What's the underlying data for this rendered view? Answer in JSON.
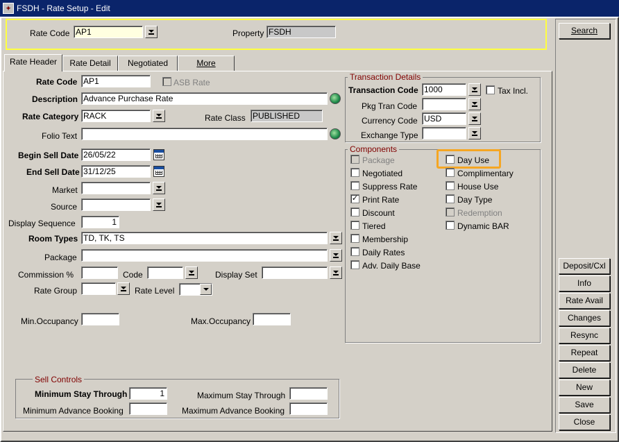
{
  "window": {
    "title": "FSDH - Rate Setup - Edit"
  },
  "header": {
    "rate_code_label": "Rate Code",
    "rate_code_value": "AP1",
    "property_label": "Property",
    "property_value": "FSDH"
  },
  "tabs": [
    {
      "label": "Rate Header",
      "active": true
    },
    {
      "label": "Rate Detail",
      "active": false
    },
    {
      "label": "Negotiated",
      "active": false
    },
    {
      "label": "More",
      "active": false
    }
  ],
  "form": {
    "rate_code_label": "Rate Code",
    "rate_code_value": "AP1",
    "asb_rate_label": "ASB Rate",
    "description_label": "Description",
    "description_value": "Advance Purchase Rate",
    "rate_category_label": "Rate Category",
    "rate_category_value": "RACK",
    "rate_class_label": "Rate Class",
    "rate_class_value": "PUBLISHED",
    "folio_text_label": "Folio Text",
    "folio_text_value": "",
    "begin_sell_date_label": "Begin Sell Date",
    "begin_sell_date_value": "26/05/22",
    "end_sell_date_label": "End Sell Date",
    "end_sell_date_value": "31/12/25",
    "market_label": "Market",
    "market_value": "",
    "source_label": "Source",
    "source_value": "",
    "display_sequence_label": "Display Sequence",
    "display_sequence_value": "1",
    "room_types_label": "Room Types",
    "room_types_value": "TD, TK, TS",
    "package_label": "Package",
    "package_value": "",
    "commission_label": "Commission %",
    "commission_value": "",
    "code_label": "Code",
    "code_value": "",
    "display_set_label": "Display Set",
    "display_set_value": "",
    "rate_group_label": "Rate Group",
    "rate_group_value": "",
    "rate_level_label": "Rate Level",
    "rate_level_value": "",
    "min_occupancy_label": "Min.Occupancy",
    "min_occupancy_value": "",
    "max_occupancy_label": "Max.Occupancy",
    "max_occupancy_value": ""
  },
  "transaction": {
    "title": "Transaction Details",
    "transaction_code_label": "Transaction Code",
    "transaction_code_value": "1000",
    "tax_incl_label": "Tax Incl.",
    "pkg_tran_code_label": "Pkg Tran Code",
    "pkg_tran_code_value": "",
    "currency_code_label": "Currency Code",
    "currency_code_value": "USD",
    "exchange_type_label": "Exchange Type",
    "exchange_type_value": ""
  },
  "components": {
    "title": "Components",
    "left": [
      {
        "label": "Package",
        "checked": false,
        "disabled": true
      },
      {
        "label": "Negotiated",
        "checked": false,
        "disabled": false
      },
      {
        "label": "Suppress Rate",
        "checked": false,
        "disabled": false
      },
      {
        "label": "Print Rate",
        "checked": true,
        "disabled": false
      },
      {
        "label": "Discount",
        "checked": false,
        "disabled": false
      },
      {
        "label": "Tiered",
        "checked": false,
        "disabled": false
      },
      {
        "label": "Membership",
        "checked": false,
        "disabled": false
      },
      {
        "label": "Daily Rates",
        "checked": false,
        "disabled": false
      },
      {
        "label": "Adv. Daily Base",
        "checked": false,
        "disabled": false
      }
    ],
    "right": [
      {
        "label": "Day Use",
        "checked": false,
        "disabled": false
      },
      {
        "label": "Complimentary",
        "checked": false,
        "disabled": false
      },
      {
        "label": "House Use",
        "checked": false,
        "disabled": false
      },
      {
        "label": "Day Type",
        "checked": false,
        "disabled": false
      },
      {
        "label": "Redemption",
        "checked": false,
        "disabled": true
      },
      {
        "label": "Dynamic BAR",
        "checked": false,
        "disabled": false
      }
    ]
  },
  "sell_controls": {
    "title": "Sell Controls",
    "min_stay_through_label": "Minimum Stay Through",
    "min_stay_through_value": "1",
    "max_stay_through_label": "Maximum Stay Through",
    "max_stay_through_value": "",
    "min_adv_booking_label": "Minimum Advance Booking",
    "min_adv_booking_value": "",
    "max_adv_booking_label": "Maximum Advance Booking",
    "max_adv_booking_value": ""
  },
  "buttons": {
    "search": "Search",
    "deposit_cxl": "Deposit/Cxl",
    "info": "Info",
    "rate_avail": "Rate Avail",
    "changes": "Changes",
    "resync": "Resync",
    "repeat": "Repeat",
    "delete": "Delete",
    "new": "New",
    "save": "Save",
    "close": "Close"
  }
}
